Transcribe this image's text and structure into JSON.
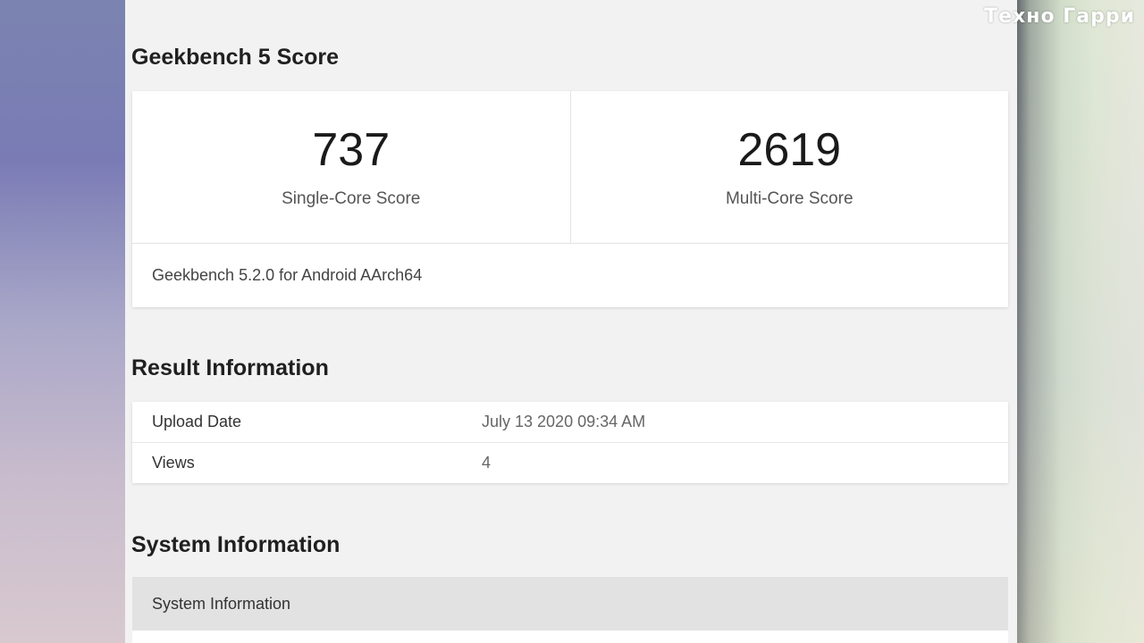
{
  "watermark": "Техно Гарри",
  "geekbench": {
    "title": "Geekbench 5 Score",
    "single_core": {
      "value": "737",
      "label": "Single-Core Score"
    },
    "multi_core": {
      "value": "2619",
      "label": "Multi-Core Score"
    },
    "version": "Geekbench 5.2.0 for Android AArch64"
  },
  "result_info": {
    "title": "Result Information",
    "rows": [
      {
        "key": "Upload Date",
        "value": "July 13 2020 09:34 AM"
      },
      {
        "key": "Views",
        "value": "4"
      }
    ]
  },
  "system_info": {
    "title": "System Information",
    "header": "System Information"
  }
}
